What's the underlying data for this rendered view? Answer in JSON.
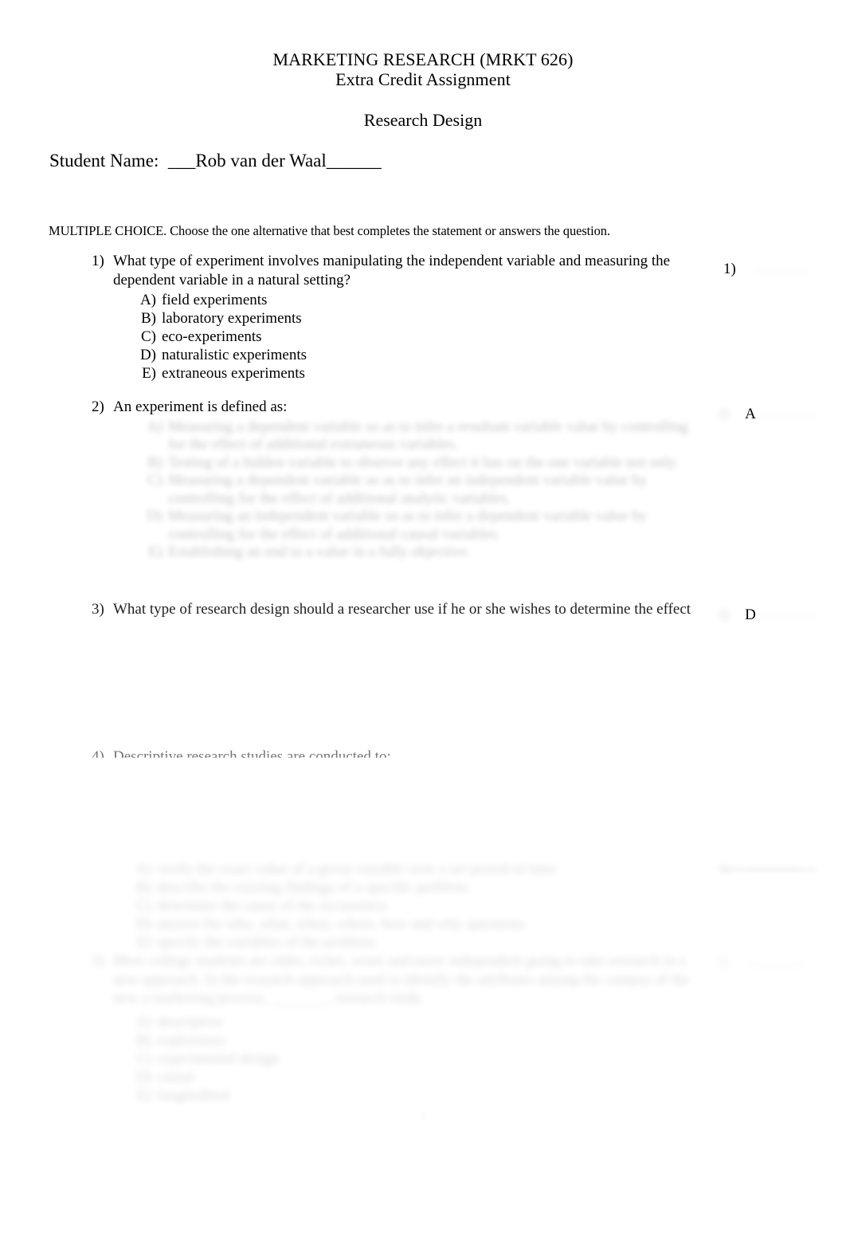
{
  "document": {
    "header": {
      "course_title": "MARKETING RESEARCH (MRKT 626)",
      "assignment_title": "Extra Credit Assignment",
      "section_title": "Research Design"
    },
    "student": {
      "label": "Student Name:  ___",
      "name": "Rob van der Waal",
      "trailing_rule": "______"
    },
    "instruction": "MULTIPLE CHOICE. Choose the one alternative that best completes the statement or answers the question.",
    "page_number": "1"
  },
  "questions": [
    {
      "number": "1)",
      "text": "What type of experiment involves manipulating the independent variable and measuring the dependent variable in a natural setting?",
      "options": [
        {
          "letter": "A)",
          "text": "field experiments"
        },
        {
          "letter": "B)",
          "text": "laboratory experiments"
        },
        {
          "letter": "C)",
          "text": "eco-experiments"
        },
        {
          "letter": "D)",
          "text": "naturalistic experiments"
        },
        {
          "letter": "E)",
          "text": "extraneous experiments"
        }
      ],
      "answer_number": "1)",
      "answer_value": ""
    },
    {
      "number": "2)",
      "text": "An experiment is defined as:",
      "options": [
        {
          "letter": "A)",
          "text": "Measuring a dependent variable so as to infer a resultant variable value by controlling for the effect of additional extraneous variables."
        },
        {
          "letter": "B)",
          "text": "Testing of a hidden variable to observe any effect it has on the one variable not only."
        },
        {
          "letter": "C)",
          "text": "Measuring a dependent variable so as to infer an independent variable value by controlling for the effect of additional analytic variables."
        },
        {
          "letter": "D)",
          "text": "Measuring an independent variable so as to infer a dependent variable value by controlling for the effect of additional causal variables."
        },
        {
          "letter": "E)",
          "text": "Establishing an end to a value in a fully objective."
        }
      ],
      "answer_number": "2)",
      "answer_value": "A"
    },
    {
      "number": "3)",
      "text": "What type of research design should a researcher use if he or she wishes to determine the effect of a change in price on the sales of a particular brand?",
      "options": [],
      "answer_number": "3)",
      "answer_value": "D"
    },
    {
      "number": "4)",
      "text": "Descriptive research studies are conducted to:",
      "options": [
        {
          "letter": "A)",
          "text": "verify the exact value of a given variable over a set period of time."
        },
        {
          "letter": "B)",
          "text": "describe the existing findings of a specific problem."
        },
        {
          "letter": "C)",
          "text": "determine the cause of the occurrence."
        },
        {
          "letter": "D)",
          "text": "answer the who, what, when, where, how and why questions."
        },
        {
          "letter": "E)",
          "text": "specify the variables of the problem."
        }
      ],
      "answer_number": "4)",
      "answer_value": ""
    },
    {
      "number": "5)",
      "text": "Most college students are older, richer, wiser and more independent going to take research in a new approach. In the research approach used to identify the attributes among the campus of the new a marketing process, ________ research study.",
      "options": [
        {
          "letter": "A)",
          "text": "descriptive"
        },
        {
          "letter": "B)",
          "text": "exploratory"
        },
        {
          "letter": "C)",
          "text": "experimental design"
        },
        {
          "letter": "D)",
          "text": "causal"
        },
        {
          "letter": "E)",
          "text": "longitudinal"
        }
      ],
      "answer_number": "5)",
      "answer_value": ""
    }
  ]
}
